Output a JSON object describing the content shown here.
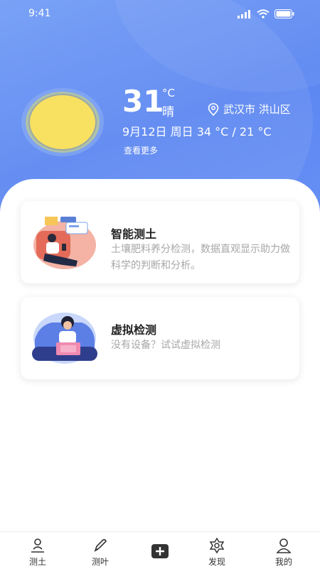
{
  "status_bar": {
    "time": "9:41"
  },
  "weather": {
    "temperature": "31",
    "unit": "°C",
    "condition": "晴",
    "location": "武汉市 洪山区",
    "date_line": "9月12日  周日 34 °C / 21 °C",
    "more_label": "查看更多",
    "sun_icon": "sun-icon",
    "location_icon": "location-pin-icon"
  },
  "cards": [
    {
      "title": "智能测土",
      "description": "土壤肥料养分检测，数据直观显示助力做科学的判断和分析。"
    },
    {
      "title": "虚拟检测",
      "description": "没有设备？试试虚拟检测"
    }
  ],
  "tabbar": {
    "items": [
      {
        "label": "测土",
        "icon": "soil-person-icon"
      },
      {
        "label": "测叶",
        "icon": "pen-icon"
      },
      {
        "label": "",
        "icon": "plus-icon"
      },
      {
        "label": "发现",
        "icon": "discover-gear-icon"
      },
      {
        "label": "我的",
        "icon": "profile-icon"
      }
    ]
  },
  "colors": {
    "hero_blue": "#5b86f2",
    "sun_yellow": "#f8e061",
    "text_gray": "#a7a7a7"
  }
}
